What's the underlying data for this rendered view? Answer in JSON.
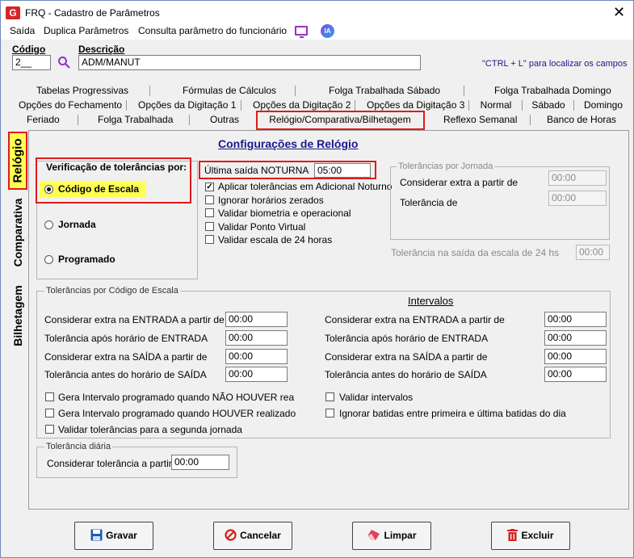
{
  "window": {
    "title": "FRQ - Cadastro de Parâmetros",
    "app_icon": "G"
  },
  "menu": {
    "items": [
      "Saída",
      "Duplica Parâmetros",
      "Consulta parâmetro do funcionário"
    ],
    "ia_label": "IA"
  },
  "header": {
    "codigo_label": "Código",
    "codigo_value": "2__",
    "descricao_label": "Descrição",
    "descricao_value": "ADM/MANUT",
    "hint": "\"CTRL + L\" para localizar os campos"
  },
  "tabs": {
    "row1": [
      "Tabelas Progressivas",
      "Fórmulas de Cálculos",
      "Folga Trabalhada Sábado",
      "Folga Trabalhada Domingo"
    ],
    "row2": [
      "Opções do Fechamento",
      "Opções da Digitação 1",
      "Opções da Digitação 2",
      "Opções da Digitação 3",
      "Normal",
      "Sábado",
      "Domingo"
    ],
    "row3": [
      "Feriado",
      "Folga Trabalhada",
      "Outras",
      "Relógio/Comparativa/Bilhetagem",
      "Reflexo Semanal",
      "Banco de Horas"
    ],
    "vertical": [
      "Relógio",
      "Comparativa",
      "Bilhetagem"
    ]
  },
  "config": {
    "title": "Configurações de Relógio",
    "verificacao_title": "Verificação de tolerâncias por:",
    "radios": [
      "Código de Escala",
      "Jornada",
      "Programado"
    ],
    "ultima_saida_label": "Última saída NOTURNA",
    "ultima_saida_value": "05:00",
    "checks": [
      {
        "label": "Aplicar tolerâncias em Adicional Noturno",
        "checked": true
      },
      {
        "label": "Ignorar horários zerados",
        "checked": false
      },
      {
        "label": "Validar biometria e operacional",
        "checked": false
      },
      {
        "label": "Validar Ponto Virtual",
        "checked": false
      },
      {
        "label": "Validar escala de 24 horas",
        "checked": false
      }
    ],
    "jornada_title": "Tolerâncias por Jornada",
    "jornada_extra_label": "Considerar extra a partir de",
    "jornada_extra_value": "00:00",
    "jornada_tol_label": "Tolerância de",
    "jornada_tol_value": "00:00",
    "saida24_label": "Tolerância na saída da escala de 24 hs",
    "saida24_value": "00:00"
  },
  "escala": {
    "title": "Tolerâncias por Código de Escala",
    "intervalos_title": "Intervalos",
    "left": [
      {
        "label": "Considerar extra na ENTRADA a partir de",
        "value": "00:00"
      },
      {
        "label": "Tolerância após horário de ENTRADA",
        "value": "00:00"
      },
      {
        "label": "Considerar extra na SAÍDA a partir de",
        "value": "00:00"
      },
      {
        "label": "Tolerância antes do horário de SAÍDA",
        "value": "00:00"
      }
    ],
    "right": [
      {
        "label": "Considerar extra na ENTRADA a partir de",
        "value": "00:00"
      },
      {
        "label": "Tolerância após horário de ENTRADA",
        "value": "00:00"
      },
      {
        "label": "Considerar extra na SAÍDA a partir de",
        "value": "00:00"
      },
      {
        "label": "Tolerância antes do horário de SAÍDA",
        "value": "00:00"
      }
    ],
    "checks_left": [
      "Gera Intervalo programado quando NÃO HOUVER rea",
      "Gera Intervalo programado quando HOUVER realizado",
      "Validar tolerâncias para a segunda jornada"
    ],
    "checks_right": [
      "Validar intervalos",
      "Ignorar batidas entre primeira e última batidas do dia"
    ]
  },
  "diaria": {
    "title": "Tolerância diária",
    "label": "Considerar tolerância a partir de",
    "value": "00:00"
  },
  "buttons": {
    "gravar": "Gravar",
    "cancelar": "Cancelar",
    "limpar": "Limpar",
    "excluir": "Excluir"
  },
  "colors": {
    "highlight": "#ffff55",
    "accent_red": "#e01b1b",
    "title_blue": "#1a1a8c"
  }
}
